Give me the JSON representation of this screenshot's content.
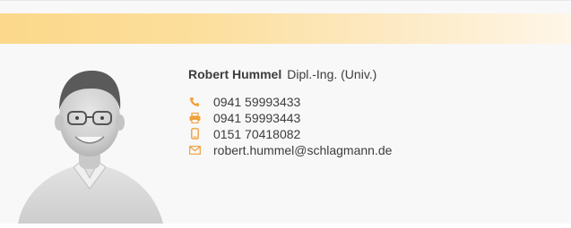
{
  "person": {
    "name": "Robert Hummel",
    "title": "Dipl.-Ing. (Univ.)"
  },
  "contacts": [
    {
      "type": "phone",
      "icon": "phone-icon",
      "value": "0941 59993433"
    },
    {
      "type": "fax",
      "icon": "printer-icon",
      "value": "0941 59993443"
    },
    {
      "type": "mobile",
      "icon": "mobile-phone-icon",
      "value": "0151 70418082"
    },
    {
      "type": "email",
      "icon": "envelope-icon",
      "value": "robert.hummel@schlagmann.de"
    }
  ],
  "colors": {
    "accent": "#f0a03c",
    "banner_start": "#fbd88a",
    "banner_end": "#fef6e8",
    "text": "#3d3d3d",
    "background": "#f8f8f8"
  }
}
